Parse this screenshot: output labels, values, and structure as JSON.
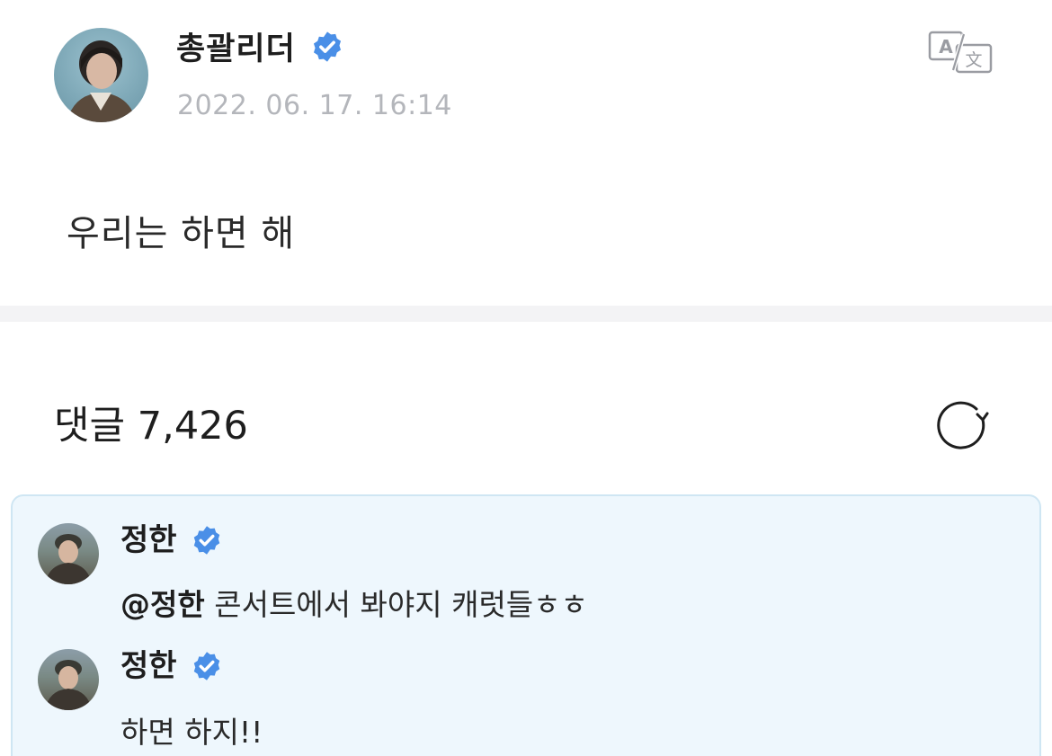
{
  "post": {
    "author": "총괄리더",
    "date": "2022. 06. 17. 16:14",
    "body": "우리는 하면 해"
  },
  "comments_header": {
    "label": "댓글",
    "count": "7,426"
  },
  "comments": [
    {
      "author": "정한",
      "mention": "@정한",
      "text": " 콘서트에서 봐야지 캐럿들ㅎㅎ"
    },
    {
      "author": "정한",
      "text": "하면 하지!!"
    }
  ],
  "colors": {
    "verified_badge": "#4a8fe7",
    "date_text": "#b4b6bb",
    "comment_card_bg": "#eef7fd",
    "divider": "#f3f3f5"
  },
  "icons": {
    "verified": "verified-badge-icon",
    "translate": "translate-icon",
    "refresh": "refresh-icon"
  }
}
